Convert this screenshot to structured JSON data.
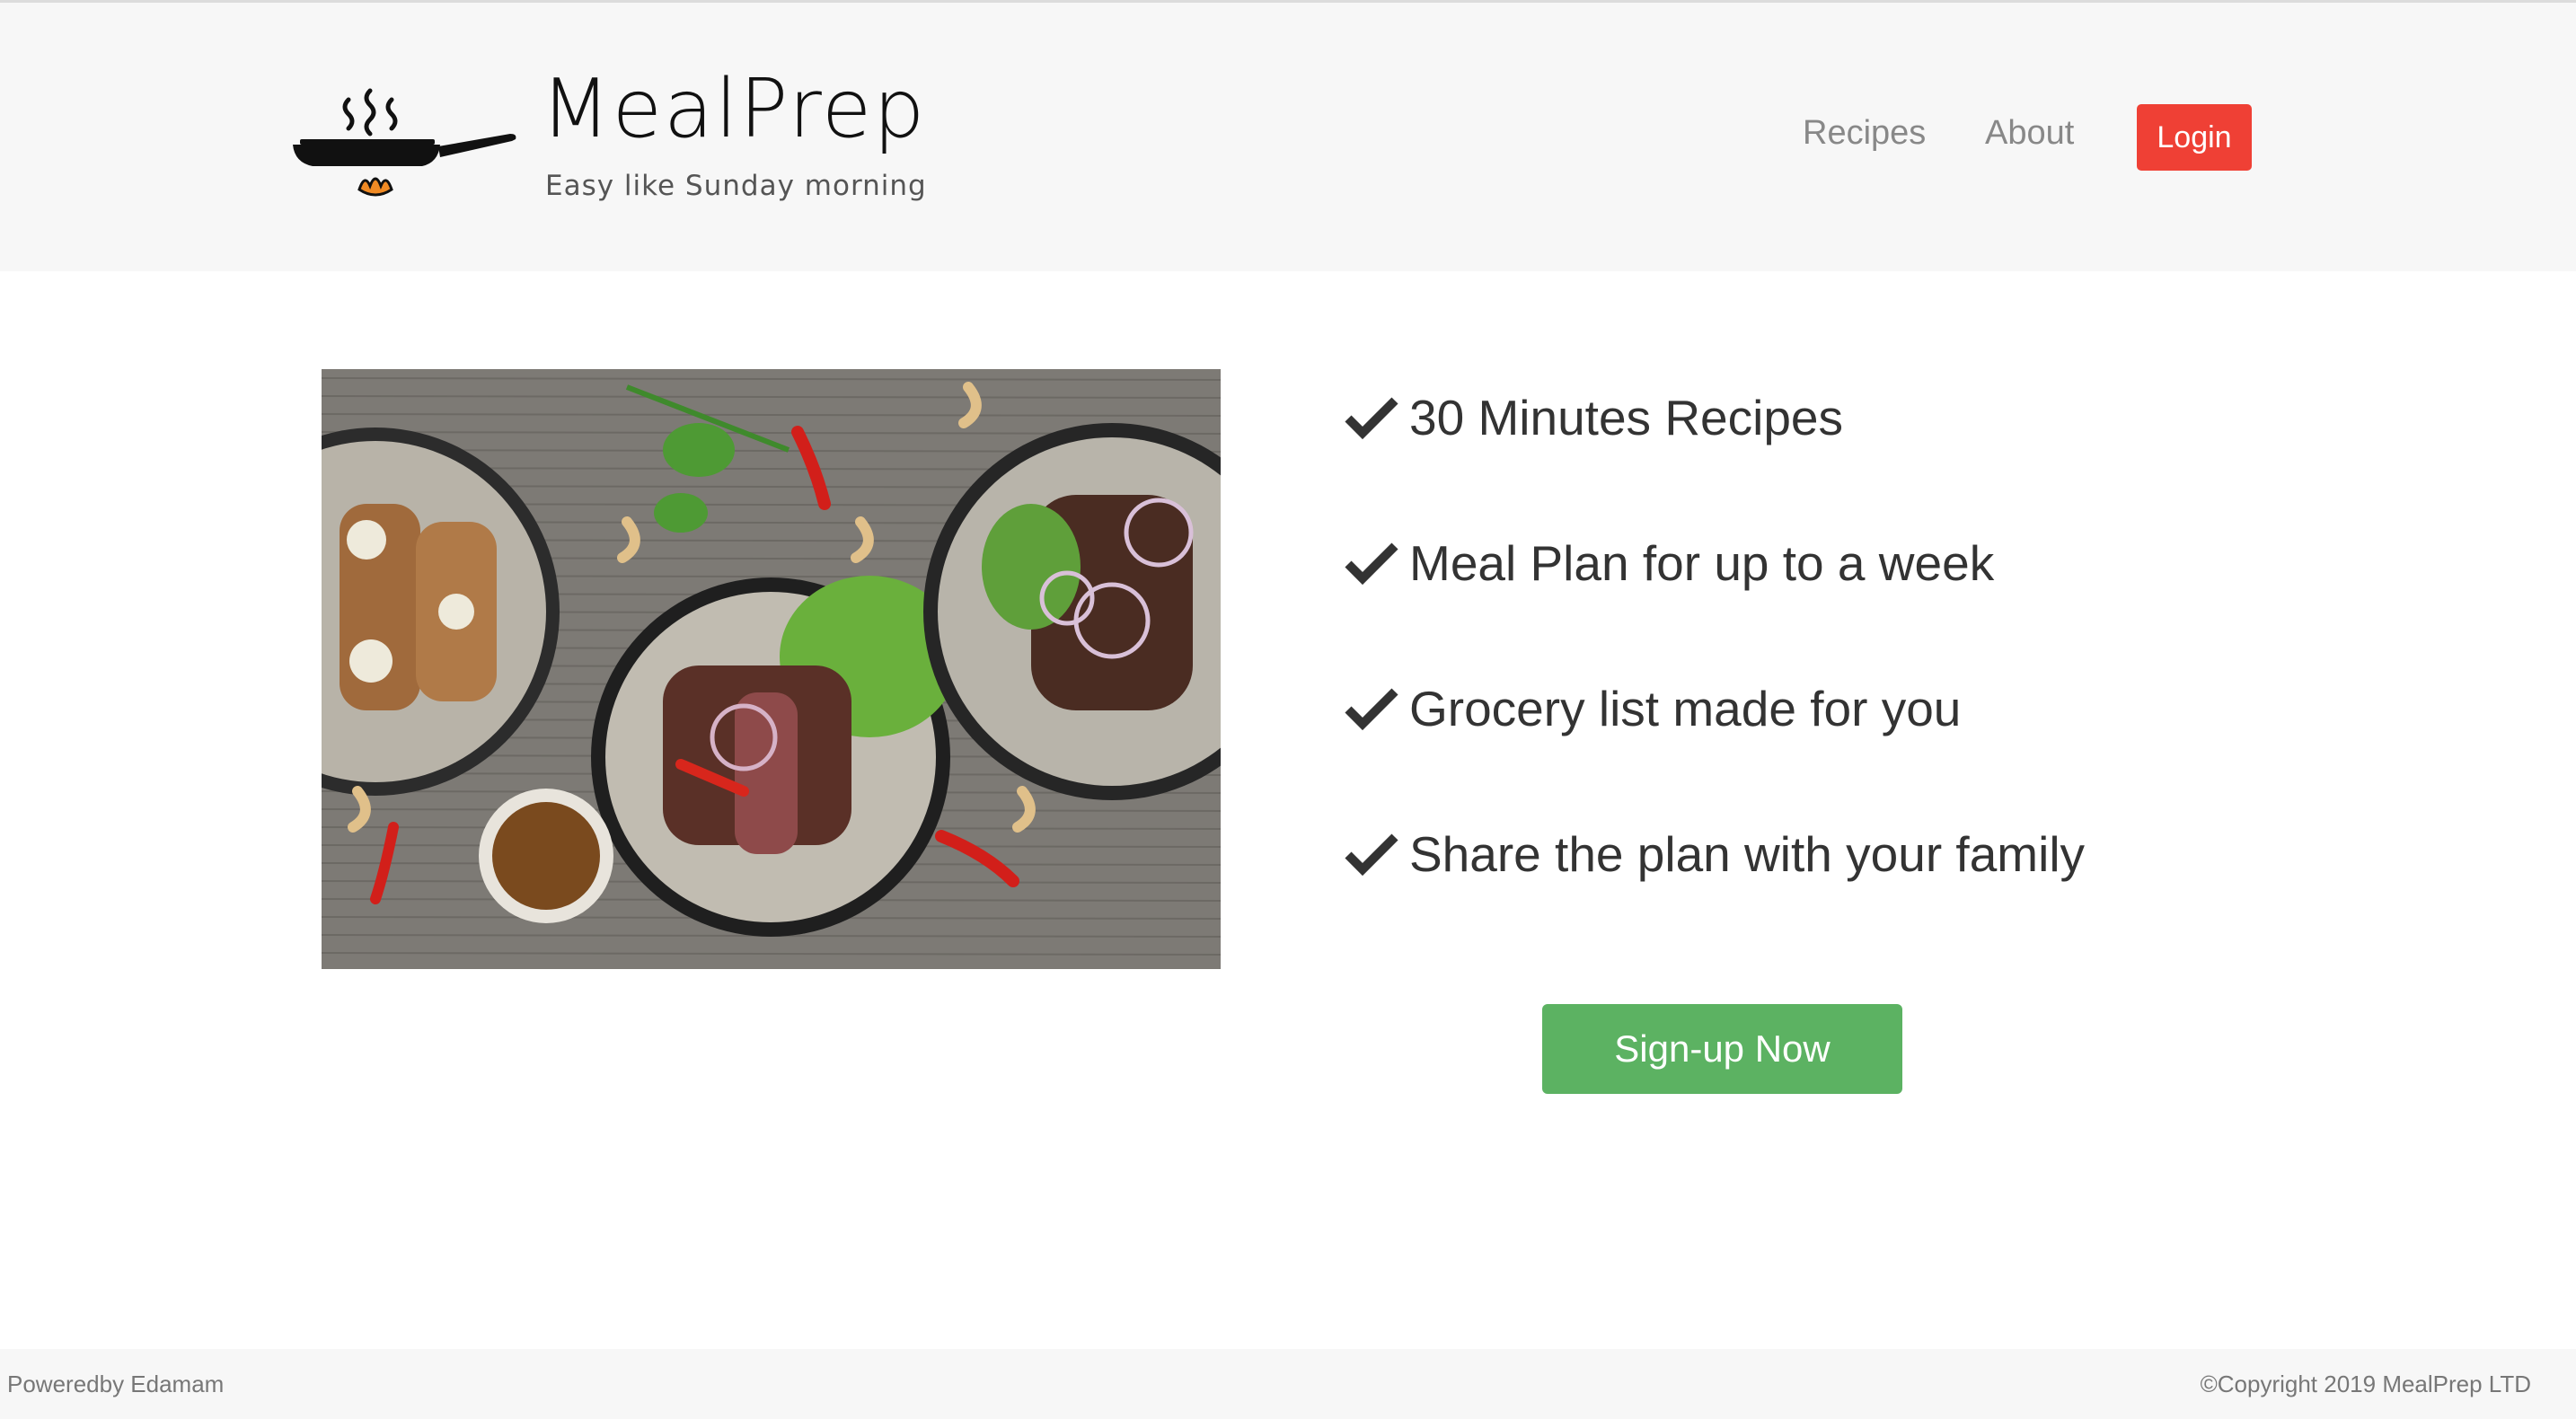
{
  "brand": {
    "name": "MealPrep",
    "tagline": "Easy like Sunday morning",
    "logo_icon": "frying-pan-icon"
  },
  "nav": {
    "items": [
      {
        "label": "Recipes"
      },
      {
        "label": "About"
      }
    ],
    "login_label": "Login"
  },
  "hero": {
    "image_alt": "food-photo",
    "features": [
      {
        "icon": "checkmark-icon",
        "text": "30 Minutes Recipes"
      },
      {
        "icon": "checkmark-icon",
        "text": "Meal Plan for up to a week"
      },
      {
        "icon": "checkmark-icon",
        "text": "Grocery list made for you"
      },
      {
        "icon": "checkmark-icon",
        "text": "Share the plan with your family"
      }
    ],
    "cta_label": "Sign-up Now"
  },
  "footer": {
    "left": "Poweredby Edamam",
    "right": "©Copyright 2019 MealPrep LTD"
  },
  "colors": {
    "login": "#ef4035",
    "signup": "#5cb262",
    "header_bg": "#f7f7f7"
  }
}
